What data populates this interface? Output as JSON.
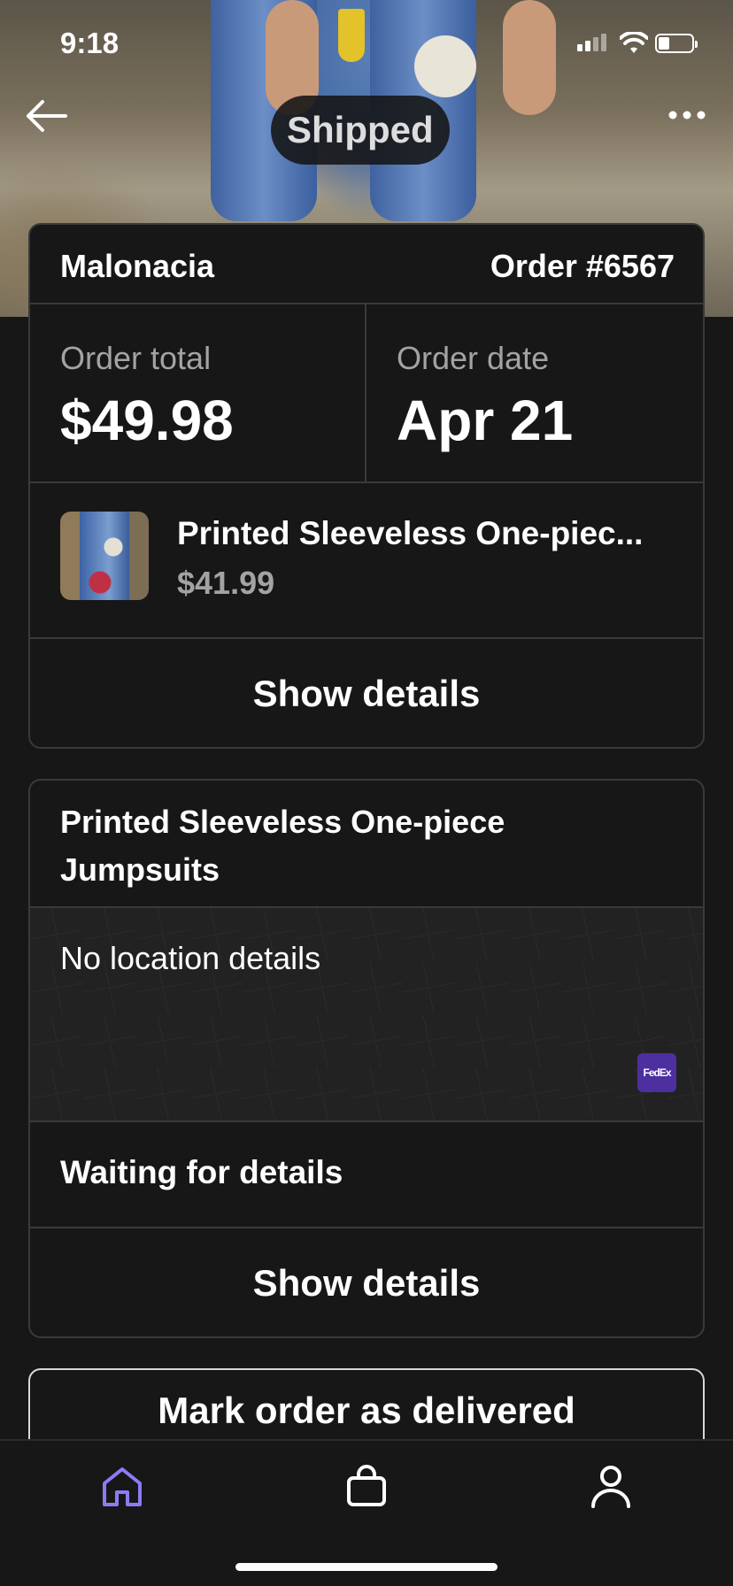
{
  "status_bar": {
    "time": "9:18"
  },
  "header": {
    "status_badge": "Shipped"
  },
  "order": {
    "store": "Malonacia",
    "order_number": "Order #6567",
    "total_label": "Order total",
    "total_value": "$49.98",
    "date_label": "Order date",
    "date_value": "Apr 21",
    "item_title": "Printed Sleeveless One-piec...",
    "item_price": "$41.99",
    "details_button": "Show details"
  },
  "shipment": {
    "item_name": "Printed Sleeveless One-piece Jumpsuits",
    "location_text": "No location details",
    "carrier_logo": "FedEx",
    "tracking_status": "Waiting for details",
    "details_button": "Show details"
  },
  "actions": {
    "mark_delivered": "Mark order as delivered"
  },
  "tab_bar": {
    "items": [
      {
        "icon": "home-icon",
        "active": true
      },
      {
        "icon": "shopping-bag-icon",
        "active": false
      },
      {
        "icon": "profile-icon",
        "active": false
      }
    ]
  },
  "colors": {
    "background": "#171717",
    "accent": "#8b7cf6",
    "border": "#3a3a3a",
    "muted_text": "#a3a3a3",
    "fedex_purple": "#4d2fa0"
  }
}
